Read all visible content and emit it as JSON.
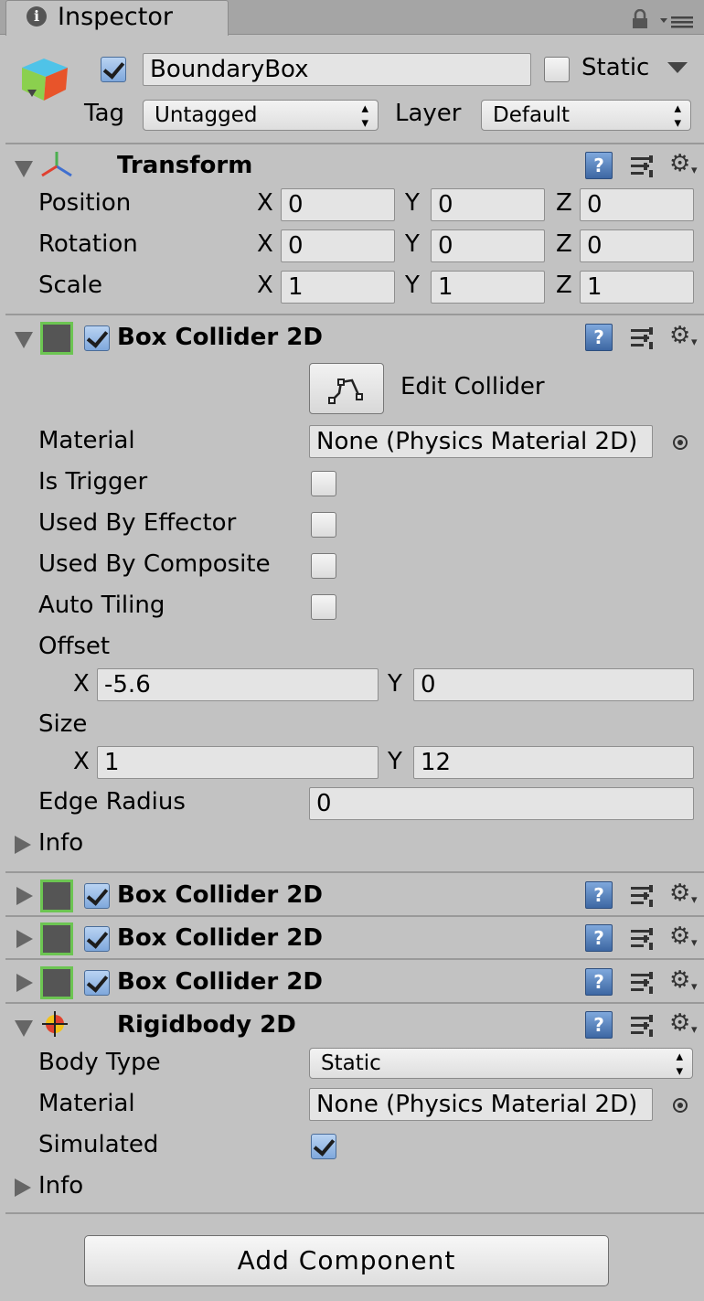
{
  "tab": {
    "title": "Inspector"
  },
  "gameobject": {
    "active": true,
    "name": "BoundaryBox",
    "static_label": "Static",
    "static": false,
    "tag_label": "Tag",
    "tag_value": "Untagged",
    "layer_label": "Layer",
    "layer_value": "Default"
  },
  "transform": {
    "title": "Transform",
    "rows": [
      {
        "label": "Position",
        "x": "0",
        "y": "0",
        "z": "0"
      },
      {
        "label": "Rotation",
        "x": "0",
        "y": "0",
        "z": "0"
      },
      {
        "label": "Scale",
        "x": "1",
        "y": "1",
        "z": "1"
      }
    ],
    "axis_x": "X",
    "axis_y": "Y",
    "axis_z": "Z"
  },
  "box_collider": {
    "title": "Box Collider 2D",
    "enabled": true,
    "edit_collider_label": "Edit Collider",
    "material_label": "Material",
    "material_value": "None (Physics Material 2D)",
    "is_trigger_label": "Is Trigger",
    "used_by_effector_label": "Used By Effector",
    "used_by_composite_label": "Used By Composite",
    "auto_tiling_label": "Auto Tiling",
    "offset_label": "Offset",
    "offset_x": "-5.6",
    "offset_y": "0",
    "size_label": "Size",
    "size_x": "1",
    "size_y": "12",
    "edge_radius_label": "Edge Radius",
    "edge_radius_value": "0",
    "info_label": "Info",
    "axis_x": "X",
    "axis_y": "Y"
  },
  "collapsed_colliders": [
    {
      "title": "Box Collider 2D"
    },
    {
      "title": "Box Collider 2D"
    },
    {
      "title": "Box Collider 2D"
    }
  ],
  "rigidbody": {
    "title": "Rigidbody 2D",
    "body_type_label": "Body Type",
    "body_type_value": "Static",
    "material_label": "Material",
    "material_value": "None (Physics Material 2D)",
    "simulated_label": "Simulated",
    "simulated": true,
    "info_label": "Info"
  },
  "add_component_label": "Add Component",
  "icons": {
    "help": "?",
    "gear": "⚙",
    "dropdown_arrows": "▴▾"
  }
}
